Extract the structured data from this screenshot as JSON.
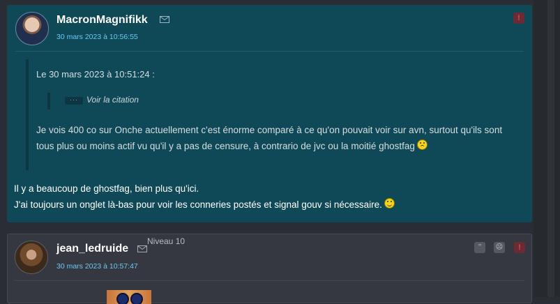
{
  "posts": [
    {
      "username": "MacronMagnifikk",
      "date": "30 mars 2023 à 10:56:55",
      "report_label": "!",
      "quote": {
        "header": "Le 30 mars 2023 à 10:51:24 :",
        "nested_button": "···",
        "nested_label": "Voir la citation",
        "text_line1": "Je vois 400 co sur Onche actuellement c'est énorme comparé à ce qu'on pouvait voir sur avn, surtout qu'ils sont",
        "text_line2": "tous plus ou moins actif vu qu'il y a pas de censure, à contrario de jvc ou la moitié ghostfag"
      },
      "body_line1": "Il y a beaucoup de ghostfag, bien plus qu'ici.",
      "body_line2": "J'ai toujours un onglet là-bas pour voir les conneries postés et signal gouv si nécessaire."
    },
    {
      "username": "jean_ledruide",
      "level": "Niveau 10",
      "date": "30 mars 2023 à 10:57:47",
      "quote_label": "”",
      "sad_label": "☹",
      "report_label": "!"
    }
  ],
  "icons": [
    "mail-icon",
    "worried-emoji-icon",
    "smile-emoji-icon"
  ],
  "colors": {
    "accent_post": "#0f4957",
    "date_link": "#69c9f3",
    "report": "#d94a5a"
  }
}
